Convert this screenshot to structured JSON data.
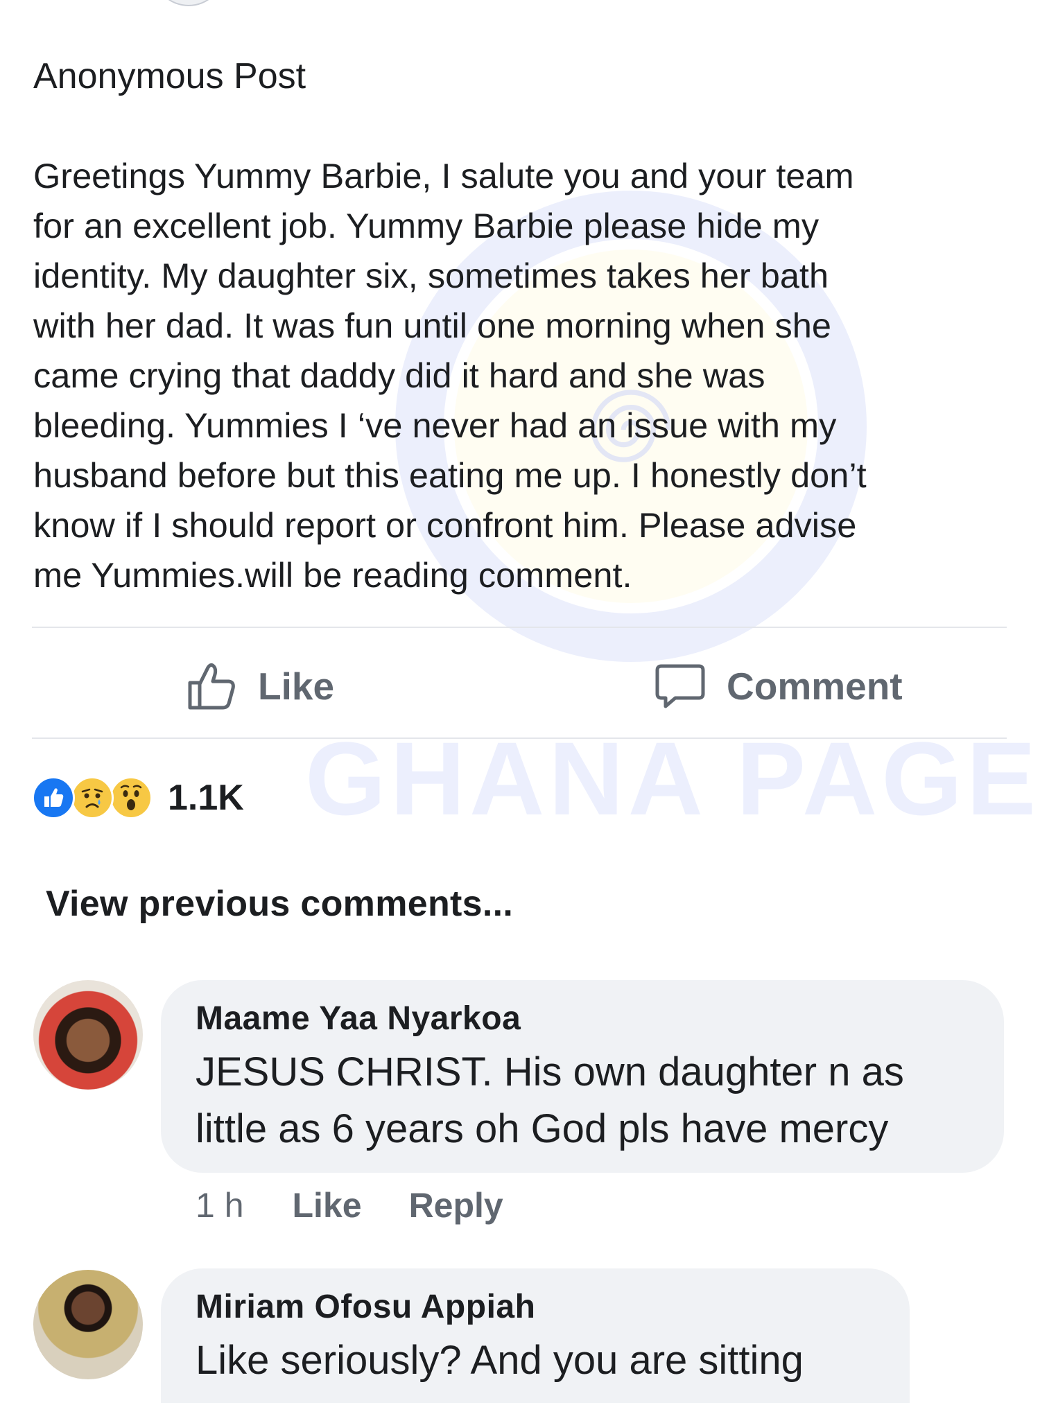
{
  "post": {
    "title": "Anonymous Post",
    "body": "Greetings Yummy Barbie, I salute you and your team\nfor an excellent job. Yummy Barbie please hide my\nidentity. My daughter six, sometimes takes her bath\nwith her dad. It was fun until one morning when she\ncame crying that daddy did it hard and she was\nbleeding. Yummies I ‘ve never had an issue with my\nhusband before but this eating me up. I honestly don’t\nknow if I should report or confront him. Please advise\nme Yummies.will be reading comment."
  },
  "actions": {
    "like_label": "Like",
    "comment_label": "Comment"
  },
  "reactions": {
    "types": [
      "like-icon",
      "sad-icon",
      "wow-icon"
    ],
    "count": "1.1K"
  },
  "comments_section": {
    "view_previous": "View previous comments..."
  },
  "comments": [
    {
      "author": "Maame Yaa Nyarkoa",
      "text": "JESUS CHRIST. His own daughter n as little as 6 years oh God pls have mercy",
      "time": "1 h",
      "like_label": "Like",
      "reply_label": "Reply"
    },
    {
      "author": "Miriam Ofosu Appiah",
      "text": "Like seriously? And you are sitting"
    }
  ],
  "watermark": {
    "text": "GHANA PAGE"
  },
  "colors": {
    "text": "#1c1e21",
    "secondary": "#606770",
    "bubble": "#f0f2f5",
    "divider": "#e4e6eb",
    "like_blue": "#1877f2",
    "emoji_yellow": "#f7c844"
  }
}
